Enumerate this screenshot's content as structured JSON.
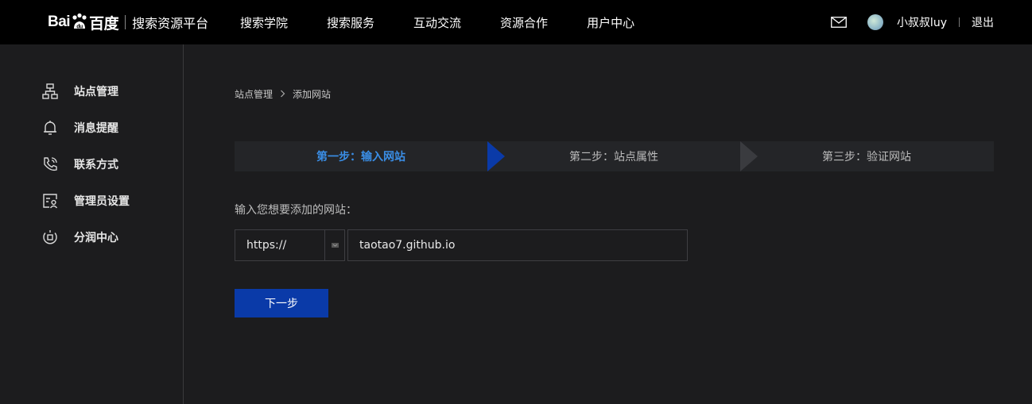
{
  "header": {
    "logo_text": "搜索资源平台",
    "logo_brand_left": "Bai",
    "logo_brand_right": "百度",
    "nav": [
      "搜索学院",
      "搜索服务",
      "互动交流",
      "资源合作",
      "用户中心"
    ],
    "username": "小叔叔luy",
    "logout": "退出",
    "icons": {
      "mail": "mail-icon",
      "avatar": "avatar"
    }
  },
  "sidebar": {
    "items": [
      {
        "label": "站点管理",
        "icon": "sitemap-icon"
      },
      {
        "label": "消息提醒",
        "icon": "bell-icon"
      },
      {
        "label": "联系方式",
        "icon": "phone-icon"
      },
      {
        "label": "管理员设置",
        "icon": "admin-icon"
      },
      {
        "label": "分润中心",
        "icon": "share-icon"
      }
    ]
  },
  "breadcrumb": {
    "items": [
      "站点管理",
      "添加网站"
    ]
  },
  "steps": [
    {
      "label": "第一步：输入网站",
      "state": "active"
    },
    {
      "label": "第二步：站点属性",
      "state": "pending"
    },
    {
      "label": "第三步：验证网站",
      "state": "pending"
    }
  ],
  "form": {
    "label": "输入您想要添加的网站：",
    "protocol": "https://",
    "url_value": "taotao7.github.io",
    "submit": "下一步"
  },
  "colors": {
    "topbar": "#000000",
    "background": "#1c1c1e",
    "accent": "#3a8ee6",
    "button": "#0a3aa8",
    "step_active_arrow": "#0a3aa8"
  }
}
